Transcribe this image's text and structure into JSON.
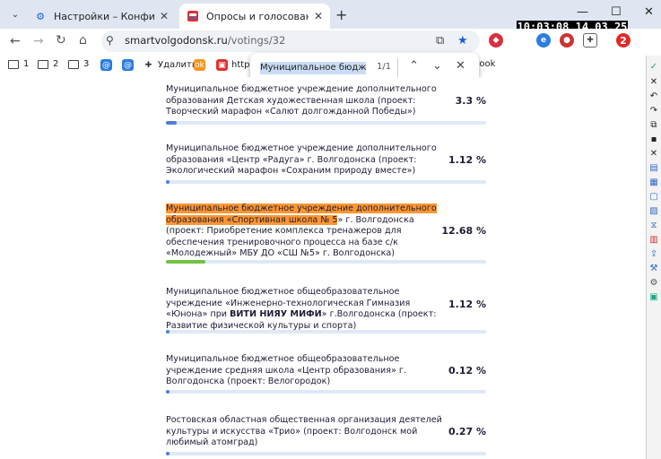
{
  "tabs": [
    {
      "title": "Настройки – Конфиденциальн",
      "active": false
    },
    {
      "title": "Опросы и голосования | Умн",
      "active": true
    }
  ],
  "clock": "10:03:08 14.03.25",
  "address": {
    "host": "smartvolgodonsk.ru",
    "path": "/votings/32"
  },
  "bookmarks": [
    {
      "label": "1",
      "type": "folder"
    },
    {
      "label": "2",
      "type": "folder"
    },
    {
      "label": "3",
      "type": "folder"
    },
    {
      "label": "@",
      "type": "link"
    },
    {
      "label": "@",
      "type": "link"
    },
    {
      "label": "Удалить",
      "type": "link"
    },
    {
      "label": "https",
      "type": "link"
    },
    {
      "label": "book",
      "type": "link"
    }
  ],
  "find": {
    "query": "Муниципальное бюджетное у",
    "count": "1/1"
  },
  "extension_badge": "2",
  "items": [
    {
      "text": "Муниципальное бюджетное учреждение дополнительного образования Детская художественная школа (проект: Творческий марафон «Салют долгожданной Победы»)",
      "percent": "3.3 %",
      "share": 0.033
    },
    {
      "text": "Муниципальное бюджетное учреждение дополнительного образования «Центр «Радуга» г. Волгодонска (проект: Экологический марафон «Сохраним природу вместе»)",
      "percent": "1.12 %",
      "share": 0.0112
    },
    {
      "text_hl": "Муниципальное бюджетное учреждение дополнительного образования «Спортивная школа № 5",
      "text_rest": "» г. Волгодонска (проект: Приобретение комплекса тренажеров для обеспечения тренировочного процесса на базе с/к «Молодежный» МБУ ДО «СШ №5» г. Волгодонска)",
      "percent": "12.68 %",
      "share": 0.1268
    },
    {
      "text_a": "Муниципальное бюджетное общеобразовательное учреждение «Инженерно-технологическая Гимназия «Юнона» при ",
      "text_b": "ВИТИ НИЯУ МИФИ",
      "text_c": "» г.Волгодонска (проект: Развитие физической культуры и спорта)",
      "percent": "1.12 %",
      "share": 0.0112
    },
    {
      "text": "Муниципальное бюджетное общеобразовательное учреждение средняя школа «Центр образования» г. Волгодонска (проект: Велогородок)",
      "percent": "0.12 %",
      "share": 0.0012
    },
    {
      "text": "Ростовская областная общественная организация деятелей культуры и искусства «Трио» (проект: Волгодонск мой любимый атомград)",
      "percent": "0.27 %",
      "share": 0.0027
    }
  ]
}
